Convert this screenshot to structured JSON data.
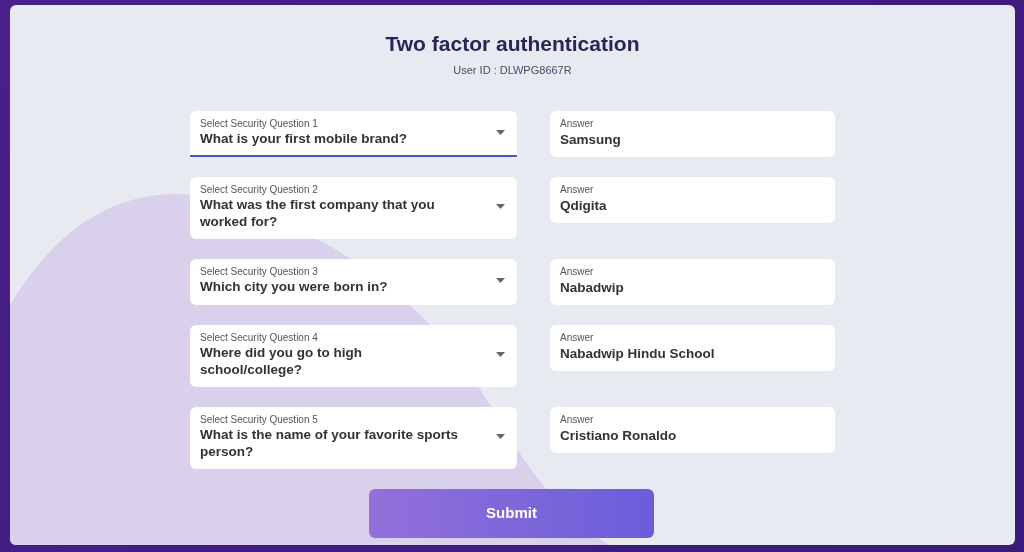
{
  "title": "Two factor authentication",
  "user_id": "User ID : DLWPG8667R",
  "rows": [
    {
      "question_label": "Select Security Question 1",
      "question": "What is your first mobile brand?",
      "focused": true,
      "answer_label": "Answer",
      "answer": "Samsung"
    },
    {
      "question_label": "Select Security Question 2",
      "question": "What was the first company that you worked for?",
      "focused": false,
      "answer_label": "Answer",
      "answer": "Qdigita"
    },
    {
      "question_label": "Select Security Question 3",
      "question": "Which city you were born in?",
      "focused": false,
      "answer_label": "Answer",
      "answer": "Nabadwip"
    },
    {
      "question_label": "Select Security Question 4",
      "question": "Where did you go to high school/college?",
      "focused": false,
      "answer_label": "Answer",
      "answer": "Nabadwip Hindu School"
    },
    {
      "question_label": "Select Security Question 5",
      "question": "What is the name of your favorite sports person?",
      "focused": false,
      "answer_label": "Answer",
      "answer": "Cristiano Ronaldo"
    }
  ],
  "submit": "Submit"
}
